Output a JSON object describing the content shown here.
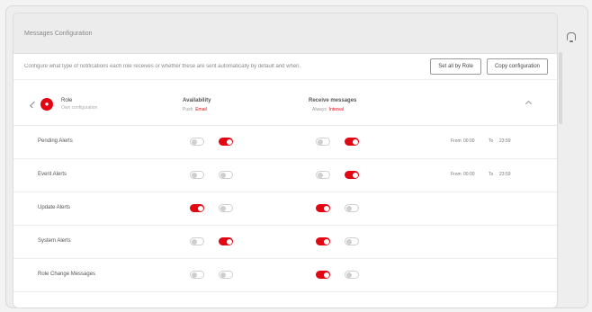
{
  "window": {
    "title": "Messages Configuration"
  },
  "toolbar": {
    "description": "Configure what type of notifications each role receives or whether these are sent automatically by default and when.",
    "btn_all": "Set all by Role",
    "btn_copy": "Copy configuration"
  },
  "group": {
    "role_name": "Role",
    "role_sub": "Own configuration",
    "col1_title": "Availability",
    "col1_sub_a": "Push",
    "col1_sub_b": "Email",
    "col2_title": "Receive messages",
    "col2_sub_a": "Always",
    "col2_sub_b": "Interval"
  },
  "rows": [
    {
      "label": "Pending Alerts",
      "push": false,
      "email": true,
      "always": false,
      "interval": true,
      "time": {
        "from_label": "From",
        "from": "00:00",
        "to_label": "To",
        "to": "23:59"
      }
    },
    {
      "label": "Event Alerts",
      "push": false,
      "email": false,
      "always": false,
      "interval": true,
      "time": {
        "from_label": "From",
        "from": "00:00",
        "to_label": "To",
        "to": "23:59"
      }
    },
    {
      "label": "Update Alerts",
      "push": true,
      "email": false,
      "always": true,
      "interval": false
    },
    {
      "label": "System Alerts",
      "push": false,
      "email": true,
      "always": true,
      "interval": false
    },
    {
      "label": "Role Change Messages",
      "push": false,
      "email": false,
      "always": true,
      "interval": false
    }
  ],
  "colors": {
    "accent": "#e30613",
    "toggle_off": "#cfcfcf"
  }
}
